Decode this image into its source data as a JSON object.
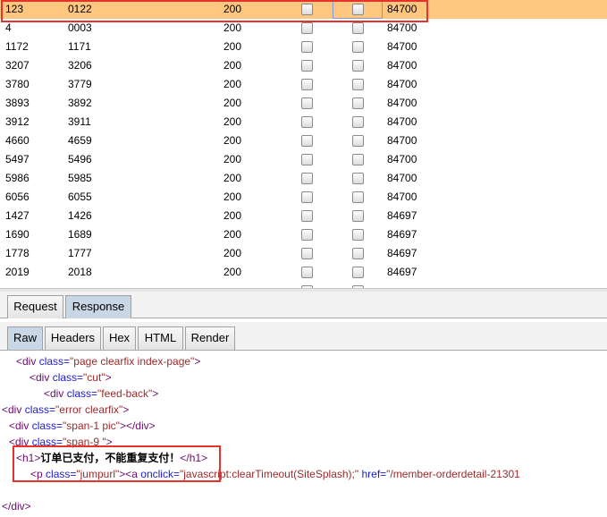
{
  "results": {
    "rows": [
      {
        "request": "123",
        "payload": "0122",
        "status": "200",
        "length": "84700",
        "selected": true
      },
      {
        "request": "4",
        "payload": "0003",
        "status": "200",
        "length": "84700"
      },
      {
        "request": "1172",
        "payload": "1171",
        "status": "200",
        "length": "84700"
      },
      {
        "request": "3207",
        "payload": "3206",
        "status": "200",
        "length": "84700"
      },
      {
        "request": "3780",
        "payload": "3779",
        "status": "200",
        "length": "84700"
      },
      {
        "request": "3893",
        "payload": "3892",
        "status": "200",
        "length": "84700"
      },
      {
        "request": "3912",
        "payload": "3911",
        "status": "200",
        "length": "84700"
      },
      {
        "request": "4660",
        "payload": "4659",
        "status": "200",
        "length": "84700"
      },
      {
        "request": "5497",
        "payload": "5496",
        "status": "200",
        "length": "84700"
      },
      {
        "request": "5986",
        "payload": "5985",
        "status": "200",
        "length": "84700"
      },
      {
        "request": "6056",
        "payload": "6055",
        "status": "200",
        "length": "84700"
      },
      {
        "request": "1427",
        "payload": "1426",
        "status": "200",
        "length": "84697"
      },
      {
        "request": "1690",
        "payload": "1689",
        "status": "200",
        "length": "84697"
      },
      {
        "request": "1778",
        "payload": "1777",
        "status": "200",
        "length": "84697"
      },
      {
        "request": "2019",
        "payload": "2018",
        "status": "200",
        "length": "84697"
      },
      {
        "request": "",
        "payload": "",
        "status": "",
        "length": ""
      }
    ]
  },
  "tabs_top": [
    "Request",
    "Response"
  ],
  "tabs_top_active": "Response",
  "tabs_view": [
    "Raw",
    "Headers",
    "Hex",
    "HTML",
    "Render"
  ],
  "tabs_view_active": "Raw",
  "code": {
    "l1": {
      "tag": "<div",
      "attr": " class=",
      "val": "\"page clearfix index-page\"",
      "end": ">"
    },
    "l2": {
      "tag": "<div",
      "attr": " class=",
      "val": "\"cut\"",
      "end": ">"
    },
    "l3": {
      "tag": "<div",
      "attr": " class=",
      "val": "\"feed-back\"",
      "end": ">"
    },
    "l4": {
      "tag": "<div",
      "attr": " class=",
      "val": "\"error clearfix\"",
      "end": ">"
    },
    "l5": {
      "tag": "<div",
      "attr": " class=",
      "val": "\"span-1 pic\"",
      "end": "></div>"
    },
    "l6": {
      "tag": "<div",
      "attr": " class=",
      "val": "\"span-9 \"",
      "end": ">"
    },
    "l7": {
      "open": "<h1>",
      "text": "订单已支付，不能重复支付！",
      "close": "</h1>"
    },
    "l8": {
      "tag": "<p",
      "attr": " class=",
      "val": "\"jumpurl\"",
      "mid": "><a",
      "attr2": " onclick=",
      "val2": "\"javascript:clearTimeout(SiteSplash);\"",
      "attr3": " href=",
      "val3": "\"/member-orderdetail-21301"
    },
    "l9": {
      "tag": "</div>"
    }
  }
}
